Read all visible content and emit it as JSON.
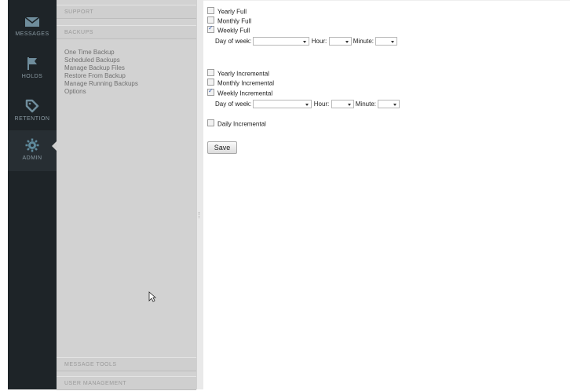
{
  "rail": {
    "items": [
      {
        "label": "MESSAGES",
        "icon": "envelope-icon"
      },
      {
        "label": "HOLDS",
        "icon": "flag-icon"
      },
      {
        "label": "RETENTION",
        "icon": "tag-icon"
      },
      {
        "label": "ADMIN",
        "icon": "gear-icon"
      }
    ]
  },
  "sidebar": {
    "headers": [
      "SUPPORT",
      "BACKUPS",
      "MESSAGE TOOLS",
      "USER MANAGEMENT"
    ],
    "items": [
      "One Time Backup",
      "Scheduled Backups",
      "Manage Backup Files",
      "Restore From Backup",
      "Manage Running Backups",
      "Options"
    ]
  },
  "form": {
    "full": [
      {
        "label": "Yearly Full",
        "checked": false
      },
      {
        "label": "Monthly Full",
        "checked": false
      },
      {
        "label": "Weekly Full",
        "checked": true
      }
    ],
    "incremental": [
      {
        "label": "Yearly Incremental",
        "checked": false
      },
      {
        "label": "Monthly Incremental",
        "checked": false
      },
      {
        "label": "Weekly Incremental",
        "checked": true
      }
    ],
    "daily": {
      "label": "Daily Incremental",
      "checked": false
    },
    "day_of_week_label": "Day of week:",
    "hour_label": "Hour:",
    "minute_label": "Minute:",
    "day_value": "",
    "hour_value": "",
    "minute_value": "",
    "save_label": "Save"
  },
  "colors": {
    "rail_bg": "#1e2428",
    "sidebar_bg": "#d2d2d2",
    "icon": "#6f8d9c",
    "active_icon": "#5f8a9c"
  }
}
